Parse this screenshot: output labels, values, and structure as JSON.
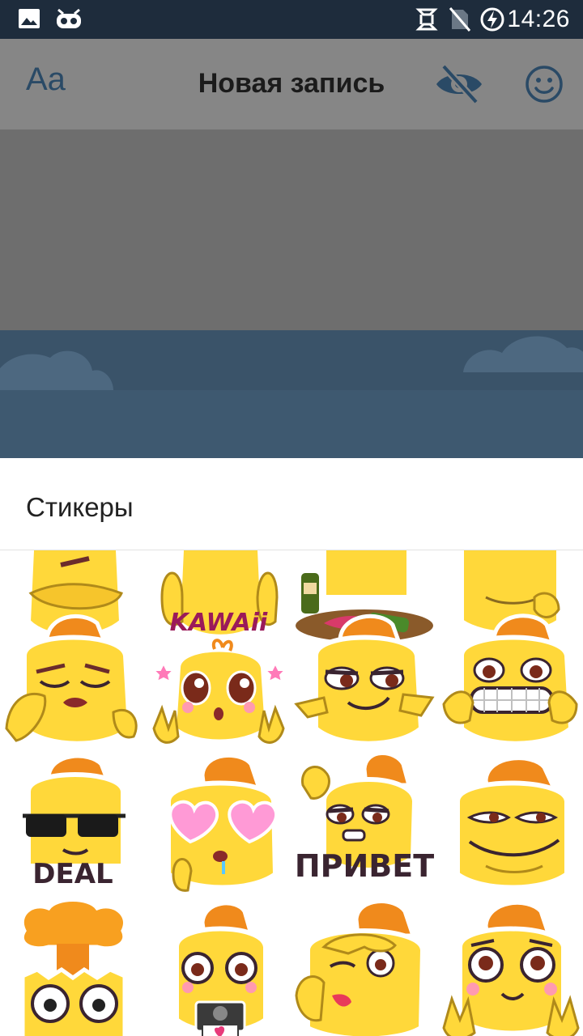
{
  "status_bar": {
    "time": "14:26",
    "icons": [
      "image-icon",
      "cyanogen-icon",
      "sync-icon",
      "no-sim-icon",
      "battery-charging-icon"
    ]
  },
  "header": {
    "font_toggle_label": "Aa",
    "title": "Новая запись",
    "icons": [
      "eye-off-icon",
      "smile-icon"
    ]
  },
  "sheet": {
    "title": "Стикеры",
    "captions": {
      "kawaii": "KAWAii",
      "deal": "DEAL",
      "privet": "ПРИВЕТ"
    }
  },
  "colors": {
    "status_bar": "#1e2c3c",
    "header_dim": "#868686",
    "accent": "#2a4a66",
    "sticker_yellow": "#ffd83a",
    "sticker_orange": "#f08a1c"
  }
}
